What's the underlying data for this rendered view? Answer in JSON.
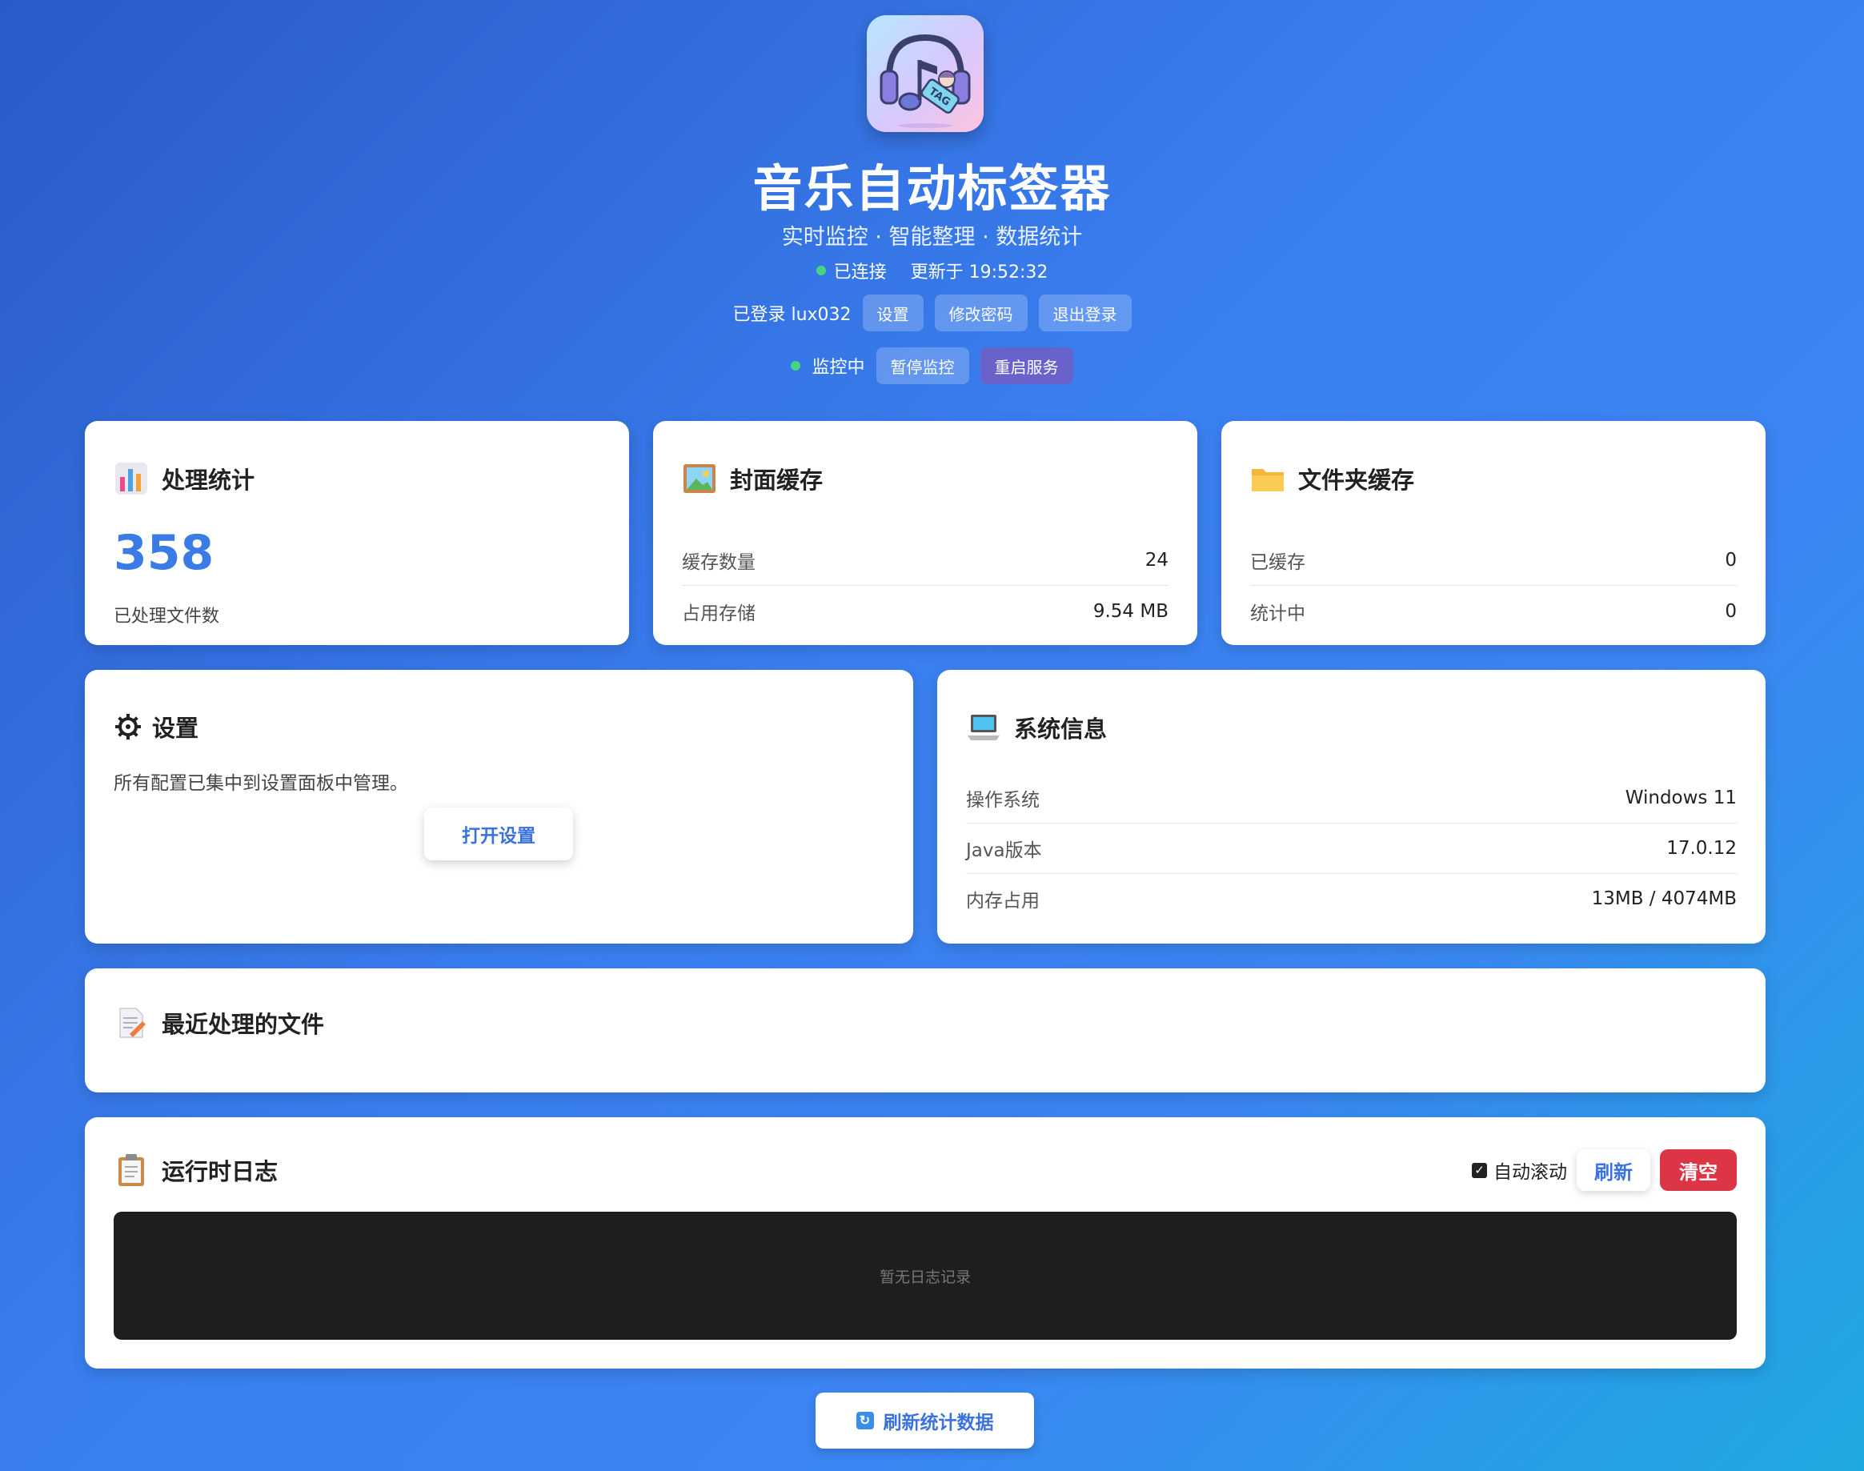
{
  "header": {
    "app_title": "音乐自动标签器",
    "subtitle": "实时监控 · 智能整理 · 数据统计",
    "connection_status": "已连接",
    "updated_at": "更新于 19:52:32",
    "logged_in_user": "已登录 lux032",
    "buttons": {
      "settings": "设置",
      "change_password": "修改密码",
      "logout": "退出登录"
    },
    "monitor_status": "监控中",
    "pause_monitor": "暂停监控",
    "restart_service": "重启服务",
    "logo_tag_text": "TAG"
  },
  "stats_card": {
    "title": "处理统计",
    "count": "358",
    "count_label": "已处理文件数"
  },
  "cover_cache_card": {
    "title": "封面缓存",
    "rows": [
      {
        "key": "缓存数量",
        "value": "24"
      },
      {
        "key": "占用存储",
        "value": "9.54 MB"
      }
    ]
  },
  "folder_cache_card": {
    "title": "文件夹缓存",
    "rows": [
      {
        "key": "已缓存",
        "value": "0"
      },
      {
        "key": "统计中",
        "value": "0"
      }
    ]
  },
  "settings_card": {
    "title": "设置",
    "description": "所有配置已集中到设置面板中管理。",
    "open_button": "打开设置"
  },
  "system_info_card": {
    "title": "系统信息",
    "rows": [
      {
        "key": "操作系统",
        "value": "Windows 11"
      },
      {
        "key": "Java版本",
        "value": "17.0.12"
      },
      {
        "key": "内存占用",
        "value": "13MB / 4074MB"
      }
    ]
  },
  "recent_files_card": {
    "title": "最近处理的文件"
  },
  "log_card": {
    "title": "运行时日志",
    "auto_scroll_label": "自动滚动",
    "auto_scroll_checked": true,
    "refresh_button": "刷新",
    "clear_button": "清空",
    "empty_text": "暂无日志记录"
  },
  "footer": {
    "refresh_stats_button": "刷新统计数据"
  },
  "icons": {
    "stats": "bar-chart-icon",
    "cover": "picture-icon",
    "folder": "folder-icon",
    "settings": "gear-icon",
    "system": "laptop-icon",
    "recent": "memo-icon",
    "log": "clipboard-icon",
    "refresh": "refresh-icon"
  },
  "colors": {
    "accent": "#3a7be6",
    "danger": "#dc3545",
    "status_green": "#45d483"
  }
}
